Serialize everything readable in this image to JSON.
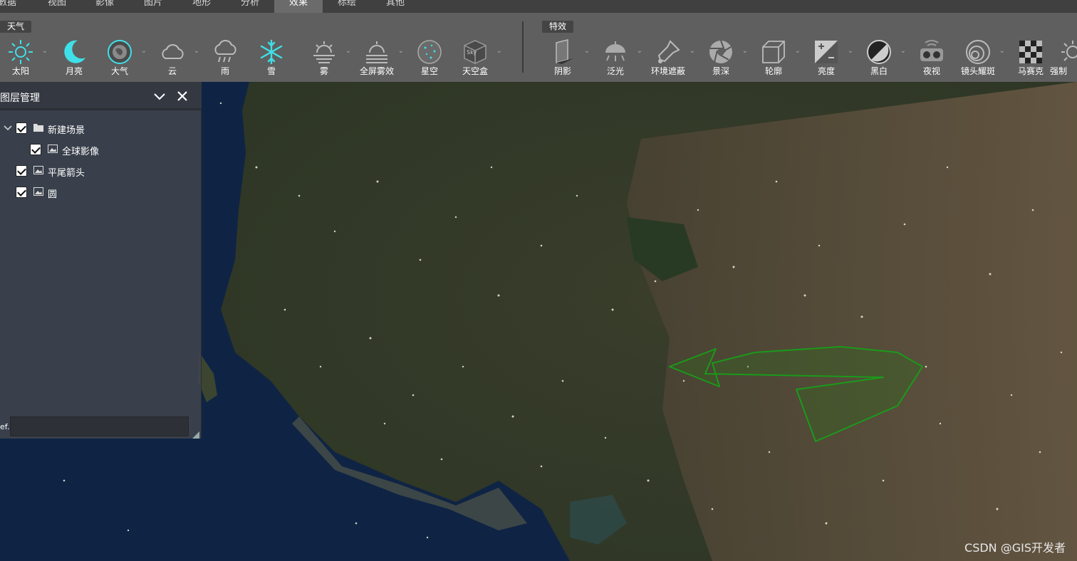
{
  "menu": {
    "tabs": [
      {
        "label": "數据",
        "active": false
      },
      {
        "label": "视图",
        "active": false
      },
      {
        "label": "影像",
        "active": false
      },
      {
        "label": "图片",
        "active": false
      },
      {
        "label": "地形",
        "active": false
      },
      {
        "label": "分析",
        "active": false
      },
      {
        "label": "效果",
        "active": true
      },
      {
        "label": "标绘",
        "active": false
      },
      {
        "label": "其他",
        "active": false
      }
    ]
  },
  "ribbon": {
    "weather_group": "天气",
    "effects_group": "特效",
    "weather_tools": [
      {
        "label": "太阳",
        "icon": "sun-icon"
      },
      {
        "label": "月亮",
        "icon": "moon-icon"
      },
      {
        "label": "大气",
        "icon": "atmosphere-icon"
      },
      {
        "label": "云",
        "icon": "cloud-icon"
      },
      {
        "label": "雨",
        "icon": "rain-icon"
      },
      {
        "label": "雪",
        "icon": "snow-icon"
      },
      {
        "label": "雾",
        "icon": "fog-icon"
      },
      {
        "label": "全屏雾效",
        "icon": "fullscreen-fog-icon"
      },
      {
        "label": "星空",
        "icon": "starry-sky-icon"
      },
      {
        "label": "天空盒",
        "icon": "skybox-icon"
      }
    ],
    "effect_tools": [
      {
        "label": "阴影",
        "icon": "shadow-icon"
      },
      {
        "label": "泛光",
        "icon": "bloom-icon"
      },
      {
        "label": "环境遮蔽",
        "icon": "ambient-occlusion-icon"
      },
      {
        "label": "景深",
        "icon": "depth-of-field-icon"
      },
      {
        "label": "轮廓",
        "icon": "outline-icon"
      },
      {
        "label": "亮度",
        "icon": "brightness-icon"
      },
      {
        "label": "黑白",
        "icon": "black-white-icon"
      },
      {
        "label": "夜视",
        "icon": "night-vision-icon"
      },
      {
        "label": "镜头耀斑",
        "icon": "lens-flare-icon"
      },
      {
        "label": "马赛克",
        "icon": "mosaic-icon"
      },
      {
        "label": "强制",
        "icon": "force-icon"
      }
    ],
    "skybox_icon_text": "Sky"
  },
  "panel": {
    "title": "图层管理",
    "layers": [
      {
        "label": "新建场景",
        "type": "folder",
        "checked": true
      },
      {
        "label": "全球影像",
        "type": "image",
        "checked": true
      },
      {
        "label": "平尾箭头",
        "type": "image",
        "checked": true
      },
      {
        "label": "圆",
        "type": "image",
        "checked": true
      }
    ],
    "footer_label": "ef.",
    "footer_value": ""
  },
  "map": {
    "watermark": "CSDN @GIS开发者",
    "arrow_color": "#1a9a1a"
  }
}
